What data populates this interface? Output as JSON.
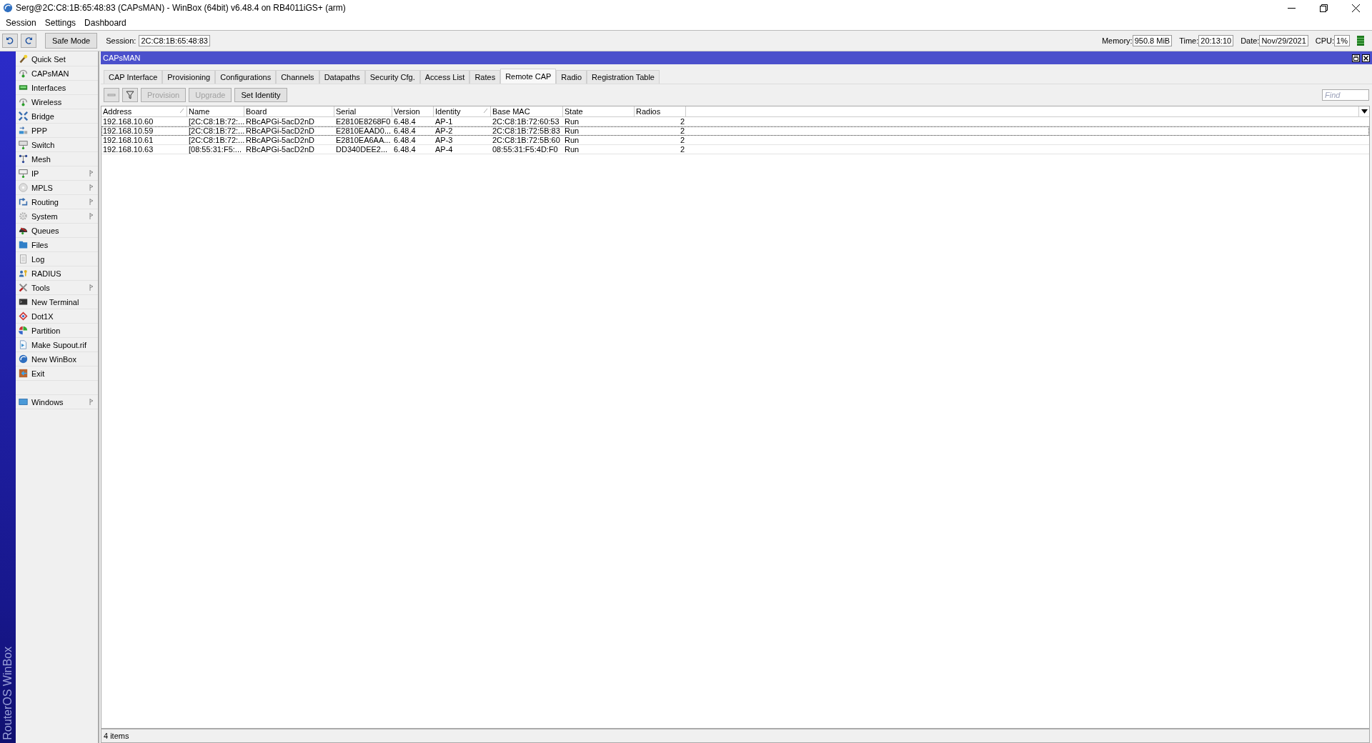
{
  "window": {
    "title": "Serg@2C:C8:1B:65:48:83 (CAPsMAN) - WinBox (64bit) v6.48.4 on RB4011iGS+ (arm)"
  },
  "menu": [
    "Session",
    "Settings",
    "Dashboard"
  ],
  "toolbar": {
    "safe_mode": "Safe Mode",
    "session_label": "Session:",
    "session_value": "2C:C8:1B:65:48:83",
    "stats": [
      {
        "label": "Memory:",
        "value": "950.8 MiB"
      },
      {
        "label": "Time:",
        "value": "20:13:10"
      },
      {
        "label": "Date:",
        "value": "Nov/29/2021"
      },
      {
        "label": "CPU:",
        "value": "1%"
      }
    ]
  },
  "side_brand": "RouterOS WinBox",
  "sidebar": {
    "items": [
      {
        "label": "Quick Set",
        "submenu": false
      },
      {
        "label": "CAPsMAN",
        "submenu": false
      },
      {
        "label": "Interfaces",
        "submenu": false
      },
      {
        "label": "Wireless",
        "submenu": false
      },
      {
        "label": "Bridge",
        "submenu": false
      },
      {
        "label": "PPP",
        "submenu": false
      },
      {
        "label": "Switch",
        "submenu": false
      },
      {
        "label": "Mesh",
        "submenu": false
      },
      {
        "label": "IP",
        "submenu": true
      },
      {
        "label": "MPLS",
        "submenu": true
      },
      {
        "label": "Routing",
        "submenu": true
      },
      {
        "label": "System",
        "submenu": true
      },
      {
        "label": "Queues",
        "submenu": false
      },
      {
        "label": "Files",
        "submenu": false
      },
      {
        "label": "Log",
        "submenu": false
      },
      {
        "label": "RADIUS",
        "submenu": false
      },
      {
        "label": "Tools",
        "submenu": true
      },
      {
        "label": "New Terminal",
        "submenu": false
      },
      {
        "label": "Dot1X",
        "submenu": false
      },
      {
        "label": "Partition",
        "submenu": false
      },
      {
        "label": "Make Supout.rif",
        "submenu": false
      },
      {
        "label": "New WinBox",
        "submenu": false
      },
      {
        "label": "Exit",
        "submenu": false
      }
    ],
    "bottom_items": [
      {
        "label": "Windows",
        "submenu": true
      }
    ]
  },
  "panel": {
    "title": "CAPsMAN",
    "tabs": [
      {
        "label": "CAP Interface",
        "selected": false
      },
      {
        "label": "Provisioning",
        "selected": false
      },
      {
        "label": "Configurations",
        "selected": false
      },
      {
        "label": "Channels",
        "selected": false
      },
      {
        "label": "Datapaths",
        "selected": false
      },
      {
        "label": "Security Cfg.",
        "selected": false
      },
      {
        "label": "Access List",
        "selected": false
      },
      {
        "label": "Rates",
        "selected": false
      },
      {
        "label": "Remote CAP",
        "selected": true
      },
      {
        "label": "Radio",
        "selected": false
      },
      {
        "label": "Registration Table",
        "selected": false
      }
    ],
    "buttons": [
      {
        "label": "Provision",
        "disabled": true
      },
      {
        "label": "Upgrade",
        "disabled": true
      },
      {
        "label": "Set Identity",
        "disabled": false
      }
    ],
    "find_placeholder": "Find",
    "table": {
      "columns": [
        {
          "label": "Address",
          "sorted": true
        },
        {
          "label": "Name",
          "sorted": false
        },
        {
          "label": "Board",
          "sorted": false
        },
        {
          "label": "Serial",
          "sorted": false
        },
        {
          "label": "Version",
          "sorted": false
        },
        {
          "label": "Identity",
          "sorted": true
        },
        {
          "label": "Base MAC",
          "sorted": false
        },
        {
          "label": "State",
          "sorted": false
        },
        {
          "label": "Radios",
          "sorted": false
        }
      ],
      "rows": [
        {
          "focused": false,
          "cells": [
            "192.168.10.60",
            "[2C:C8:1B:72:...",
            "RBcAPGi-5acD2nD",
            "E2810E8268F0",
            "6.48.4",
            "AP-1",
            "2C:C8:1B:72:60:53",
            "Run",
            "2"
          ]
        },
        {
          "focused": true,
          "cells": [
            "192.168.10.59",
            "[2C:C8:1B:72:...",
            "RBcAPGi-5acD2nD",
            "E2810EAAD0...",
            "6.48.4",
            "AP-2",
            "2C:C8:1B:72:5B:83",
            "Run",
            "2"
          ]
        },
        {
          "focused": false,
          "cells": [
            "192.168.10.61",
            "[2C:C8:1B:72:...",
            "RBcAPGi-5acD2nD",
            "E2810EA6AA...",
            "6.48.4",
            "AP-3",
            "2C:C8:1B:72:5B:60",
            "Run",
            "2"
          ]
        },
        {
          "focused": false,
          "cells": [
            "192.168.10.63",
            "[08:55:31:F5:...",
            "RBcAPGi-5acD2nD",
            "DD340DEE2...",
            "6.48.4",
            "AP-4",
            "08:55:31:F5:4D:F0",
            "Run",
            "2"
          ]
        }
      ]
    },
    "status": "4 items"
  }
}
